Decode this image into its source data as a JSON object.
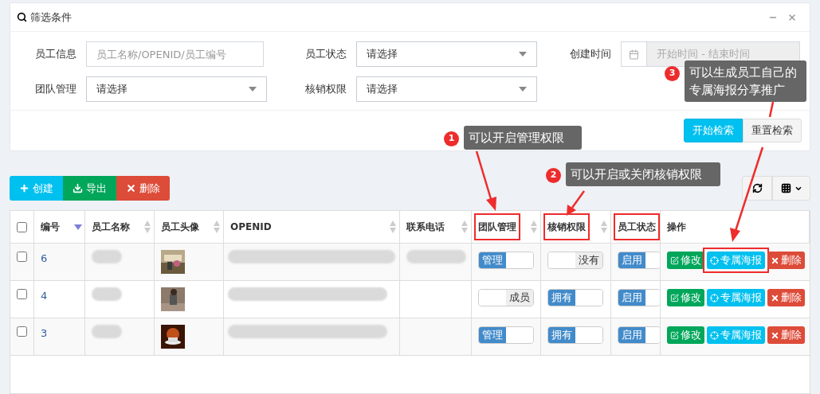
{
  "filter_panel": {
    "title": "筛选条件",
    "fields": [
      {
        "label": "员工信息",
        "kind": "text",
        "placeholder": "员工名称/OPENID/员工编号"
      },
      {
        "label": "员工状态",
        "kind": "select",
        "value": "请选择"
      },
      {
        "label": "创建时间",
        "kind": "date",
        "placeholder": "开始时间 - 结束时间"
      },
      {
        "label": "团队管理",
        "kind": "select",
        "value": "请选择"
      },
      {
        "label": "核销权限",
        "kind": "select",
        "value": "请选择"
      }
    ],
    "buttons": [
      {
        "label": "开始检索",
        "kind": "primary"
      },
      {
        "label": "重置检索",
        "kind": "default"
      }
    ]
  },
  "toolbar": {
    "buttons": [
      {
        "label": "创建",
        "kind": "create"
      },
      {
        "label": "导出",
        "kind": "export"
      },
      {
        "label": "删除",
        "kind": "delete"
      }
    ]
  },
  "table": {
    "select_all_checked": false,
    "columns": [
      {
        "label": "编号",
        "sortable": true,
        "sorted": true,
        "highlighted": false
      },
      {
        "label": "员工名称",
        "sortable": true,
        "sorted": false,
        "highlighted": false
      },
      {
        "label": "员工头像",
        "sortable": true,
        "sorted": false,
        "highlighted": false
      },
      {
        "label": "OPENID",
        "sortable": true,
        "sorted": false,
        "highlighted": false
      },
      {
        "label": "联系电话",
        "sortable": true,
        "sorted": false,
        "highlighted": false
      },
      {
        "label": "团队管理",
        "sortable": true,
        "sorted": false,
        "highlighted": true
      },
      {
        "label": "核销权限",
        "sortable": true,
        "sorted": false,
        "highlighted": true
      },
      {
        "label": "员工状态",
        "sortable": false,
        "sorted": false,
        "highlighted": true
      },
      {
        "label": "操作",
        "sortable": false,
        "sorted": false,
        "highlighted": false
      }
    ],
    "rows": [
      {
        "checked": false,
        "id": "6",
        "team": {
          "label": "管理",
          "on": true
        },
        "verify": {
          "label": "没有",
          "on": false
        },
        "status": {
          "label": "启用",
          "on": true
        },
        "actions": [
          {
            "label": "修改",
            "kind": "edit",
            "highlighted": false
          },
          {
            "label": "专属海报",
            "kind": "poster",
            "highlighted": true
          },
          {
            "label": "删除",
            "kind": "delete",
            "highlighted": false
          }
        ]
      },
      {
        "checked": false,
        "id": "4",
        "team": {
          "label": "成员",
          "on": false
        },
        "verify": {
          "label": "拥有",
          "on": true
        },
        "status": {
          "label": "启用",
          "on": true
        },
        "actions": [
          {
            "label": "修改",
            "kind": "edit",
            "highlighted": false
          },
          {
            "label": "专属海报",
            "kind": "poster",
            "highlighted": false
          },
          {
            "label": "删除",
            "kind": "delete",
            "highlighted": false
          }
        ]
      },
      {
        "checked": false,
        "id": "3",
        "team": {
          "label": "管理",
          "on": true
        },
        "verify": {
          "label": "拥有",
          "on": true
        },
        "status": {
          "label": "启用",
          "on": true
        },
        "actions": [
          {
            "label": "修改",
            "kind": "edit",
            "highlighted": false
          },
          {
            "label": "专属海报",
            "kind": "poster",
            "highlighted": false
          },
          {
            "label": "删除",
            "kind": "delete",
            "highlighted": false
          }
        ]
      }
    ]
  },
  "annotations": [
    {
      "number": "1",
      "text": "可以开启管理权限"
    },
    {
      "number": "2",
      "text": "可以开启或关闭核销权限"
    },
    {
      "number": "3",
      "text": "可以生成员工自己的专属海报分享推广"
    }
  ]
}
